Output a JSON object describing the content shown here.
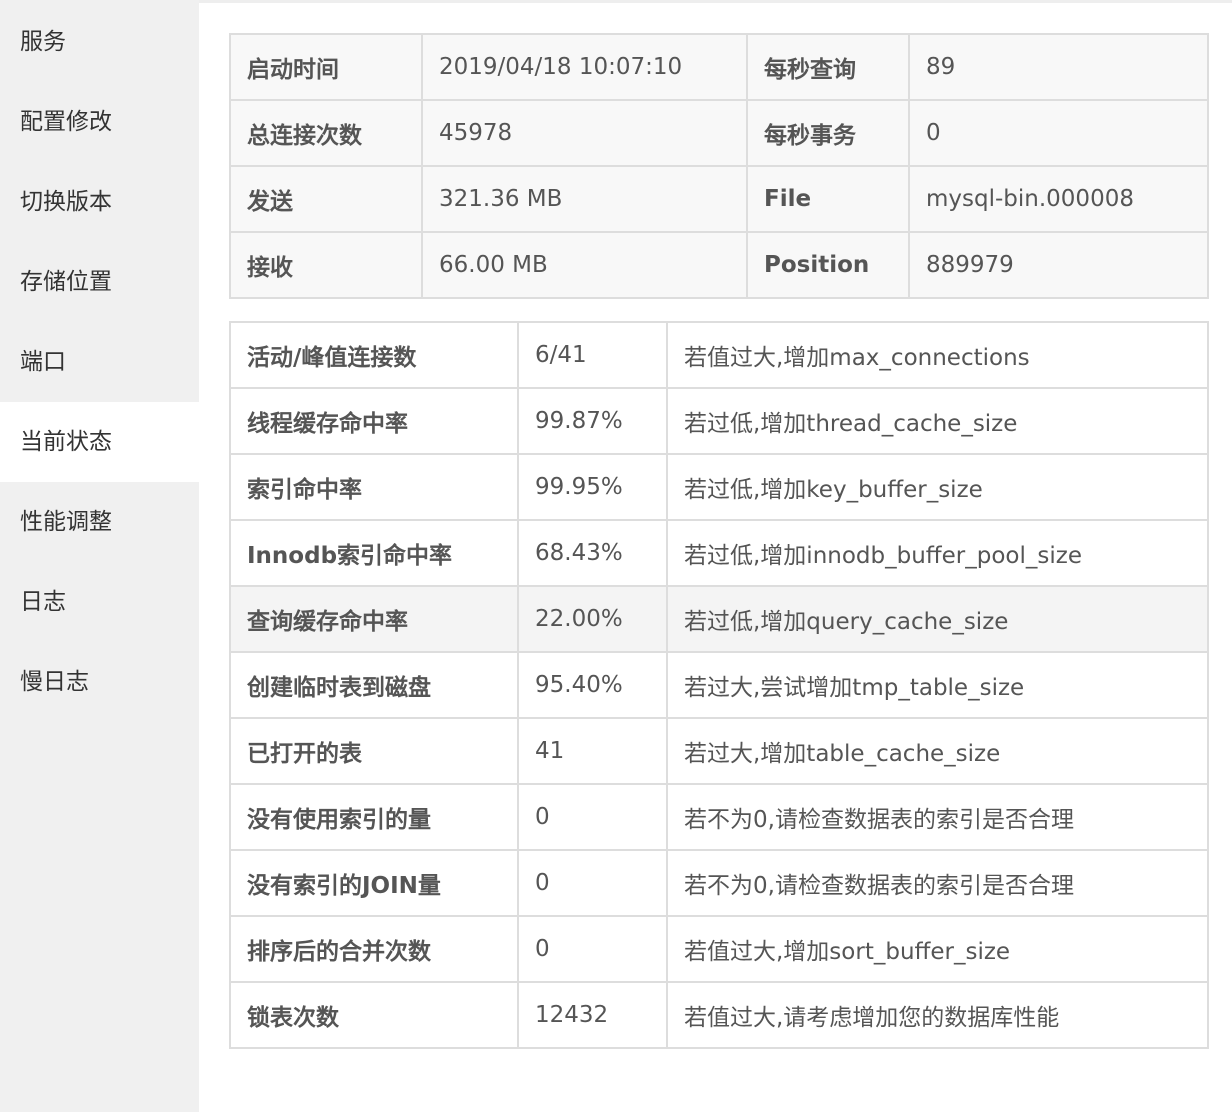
{
  "sidebar": {
    "items": [
      {
        "label": "服务"
      },
      {
        "label": "配置修改"
      },
      {
        "label": "切换版本"
      },
      {
        "label": "存储位置"
      },
      {
        "label": "端口"
      },
      {
        "label": "当前状态",
        "active": true
      },
      {
        "label": "性能调整"
      },
      {
        "label": "日志"
      },
      {
        "label": "慢日志"
      }
    ]
  },
  "status": {
    "rows": [
      {
        "k1": "启动时间",
        "v1": "2019/04/18 10:07:10",
        "k2": "每秒查询",
        "v2": "89"
      },
      {
        "k1": "总连接次数",
        "v1": "45978",
        "k2": "每秒事务",
        "v2": "0"
      },
      {
        "k1": "发送",
        "v1": "321.36 MB",
        "k2": "File",
        "v2": "mysql-bin.000008"
      },
      {
        "k1": "接收",
        "v1": "66.00 MB",
        "k2": "Position",
        "v2": "889979"
      }
    ]
  },
  "metrics": {
    "rows": [
      {
        "name": "活动/峰值连接数",
        "value": "6/41",
        "hint": "若值过大,增加max_connections"
      },
      {
        "name": "线程缓存命中率",
        "value": "99.87%",
        "hint": "若过低,增加thread_cache_size"
      },
      {
        "name": "索引命中率",
        "value": "99.95%",
        "hint": "若过低,增加key_buffer_size"
      },
      {
        "name": "Innodb索引命中率",
        "value": "68.43%",
        "hint": "若过低,增加innodb_buffer_pool_size"
      },
      {
        "name": "查询缓存命中率",
        "value": "22.00%",
        "hint": "若过低,增加query_cache_size"
      },
      {
        "name": "创建临时表到磁盘",
        "value": "95.40%",
        "hint": "若过大,尝试增加tmp_table_size"
      },
      {
        "name": "已打开的表",
        "value": "41",
        "hint": "若过大,增加table_cache_size"
      },
      {
        "name": "没有使用索引的量",
        "value": "0",
        "hint": "若不为0,请检查数据表的索引是否合理"
      },
      {
        "name": "没有索引的JOIN量",
        "value": "0",
        "hint": "若不为0,请检查数据表的索引是否合理"
      },
      {
        "name": "排序后的合并次数",
        "value": "0",
        "hint": "若值过大,增加sort_buffer_size"
      },
      {
        "name": "锁表次数",
        "value": "12432",
        "hint": "若值过大,请考虑增加您的数据库性能"
      }
    ]
  }
}
